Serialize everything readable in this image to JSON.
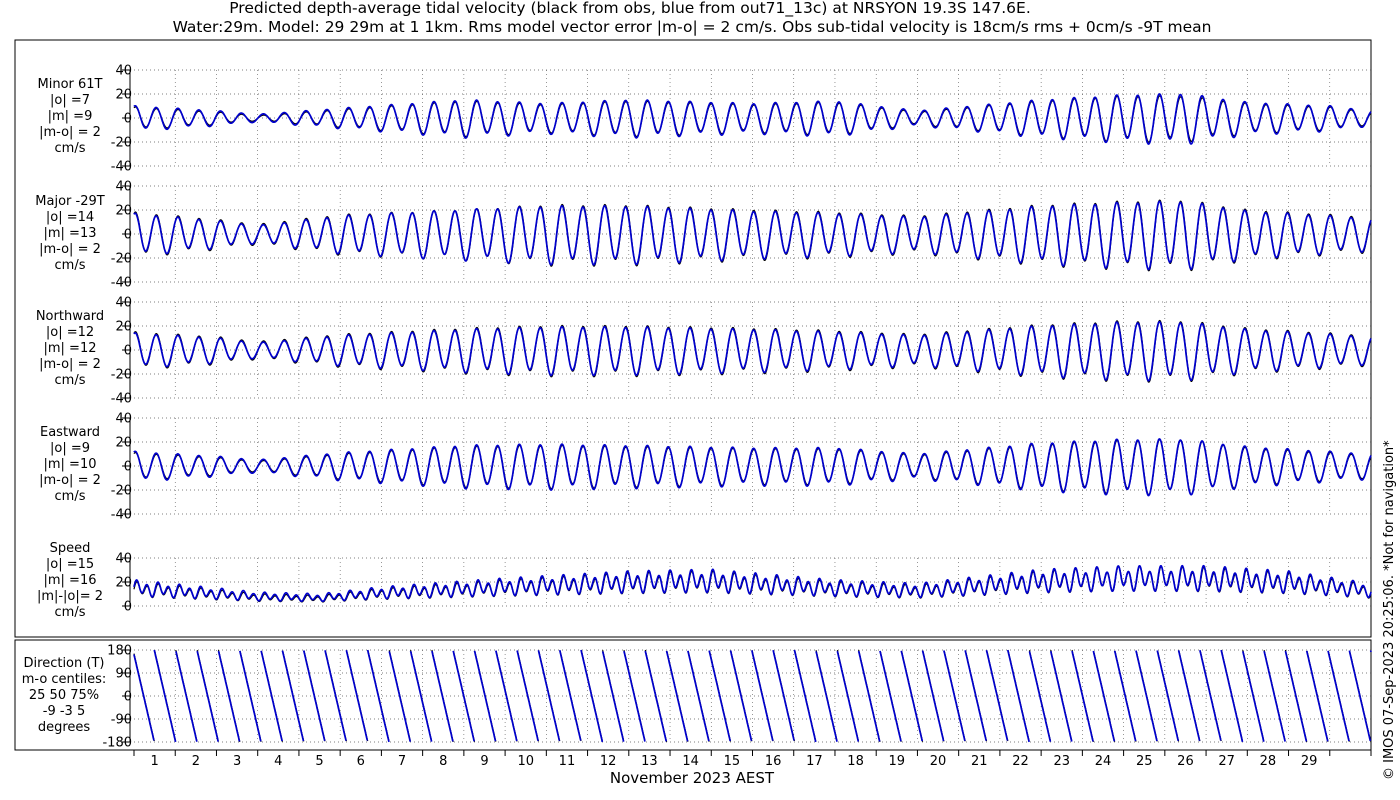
{
  "title_lines": [
    "Predicted depth-average tidal velocity (black from obs, blue from out71_13c) at NRSYON 19.3S 147.6E.",
    "Water:29m. Model: 29 29m at 1 1km. Rms model vector error |m-o| = 2 cm/s. Obs sub-tidal velocity is 18cm/s rms + 0cm/s -9T mean"
  ],
  "xlabel": "November 2023 AEST",
  "credit": "© IMOS 07-Sep-2023 20:25:06. *Not for navigation*",
  "colors": {
    "obs": "#000000",
    "model": "#0000cc",
    "grid": "#555555"
  },
  "chart_data": [
    {
      "type": "line",
      "panel": "Minor",
      "label_lines": [
        "Minor 61T",
        "|o| =7",
        "|m| =9",
        "|m-o| = 2",
        "cm/s"
      ],
      "ylim": [
        -40,
        40
      ],
      "yticks": [
        -40,
        -20,
        0,
        20,
        40
      ],
      "x_range_days": [
        0,
        30
      ],
      "series": [
        {
          "role": "obs",
          "amplitude_envelope": [
            [
              0,
              9
            ],
            [
              2,
              5
            ],
            [
              3,
              2
            ],
            [
              5,
              7
            ],
            [
              8,
              14
            ],
            [
              10,
              11
            ],
            [
              12,
              14
            ],
            [
              15,
              11
            ],
            [
              17,
              13
            ],
            [
              19,
              5
            ],
            [
              22,
              14
            ],
            [
              24,
              18
            ],
            [
              25.5,
              18
            ],
            [
              27,
              12
            ],
            [
              29,
              9
            ],
            [
              30,
              5
            ]
          ]
        },
        {
          "role": "model",
          "amplitude_envelope": [
            [
              0,
              10
            ],
            [
              2,
              6
            ],
            [
              3,
              3
            ],
            [
              5,
              8
            ],
            [
              8,
              15
            ],
            [
              10,
              12
            ],
            [
              12,
              15
            ],
            [
              15,
              12
            ],
            [
              17,
              14
            ],
            [
              19,
              6
            ],
            [
              22,
              15
            ],
            [
              24,
              19
            ],
            [
              25.5,
              20
            ],
            [
              27,
              13
            ],
            [
              29,
              10
            ],
            [
              30,
              6
            ]
          ]
        }
      ]
    },
    {
      "type": "line",
      "panel": "Major",
      "label_lines": [
        "Major -29T",
        "|o| =14",
        "|m| =13",
        "|m-o| = 2",
        "cm/s"
      ],
      "ylim": [
        -40,
        40
      ],
      "yticks": [
        -40,
        -20,
        0,
        20,
        40
      ],
      "x_range_days": [
        0,
        30
      ],
      "series": [
        {
          "role": "obs",
          "amplitude_envelope": [
            [
              0,
              18
            ],
            [
              2,
              12
            ],
            [
              3,
              8
            ],
            [
              5,
              16
            ],
            [
              8,
              20
            ],
            [
              10,
              24
            ],
            [
              12,
              24
            ],
            [
              15,
              20
            ],
            [
              17,
              18
            ],
            [
              19,
              15
            ],
            [
              22,
              24
            ],
            [
              24,
              27
            ],
            [
              25.5,
              28
            ],
            [
              27,
              20
            ],
            [
              29,
              16
            ],
            [
              30,
              14
            ]
          ]
        },
        {
          "role": "model",
          "amplitude_envelope": [
            [
              0,
              17
            ],
            [
              2,
              11
            ],
            [
              3,
              7
            ],
            [
              5,
              15
            ],
            [
              8,
              20
            ],
            [
              10,
              23
            ],
            [
              12,
              23
            ],
            [
              15,
              19
            ],
            [
              17,
              17
            ],
            [
              19,
              14
            ],
            [
              22,
              23
            ],
            [
              24,
              26
            ],
            [
              25.5,
              27
            ],
            [
              27,
              19
            ],
            [
              29,
              15
            ],
            [
              30,
              13
            ]
          ]
        }
      ]
    },
    {
      "type": "line",
      "panel": "Northward",
      "label_lines": [
        "Northward",
        "|o| =12",
        "|m| =12",
        "|m-o| = 2",
        "cm/s"
      ],
      "ylim": [
        -40,
        40
      ],
      "yticks": [
        -40,
        -20,
        0,
        20,
        40
      ],
      "x_range_days": [
        0,
        30
      ],
      "series": [
        {
          "role": "obs",
          "amplitude_envelope": [
            [
              0,
              15
            ],
            [
              2,
              11
            ],
            [
              3,
              7
            ],
            [
              5,
              13
            ],
            [
              8,
              18
            ],
            [
              10,
              20
            ],
            [
              12,
              20
            ],
            [
              15,
              18
            ],
            [
              17,
              16
            ],
            [
              19,
              13
            ],
            [
              22,
              21
            ],
            [
              24,
              24
            ],
            [
              25.5,
              24
            ],
            [
              27,
              18
            ],
            [
              29,
              14
            ],
            [
              30,
              12
            ]
          ]
        },
        {
          "role": "model",
          "amplitude_envelope": [
            [
              0,
              14
            ],
            [
              2,
              10
            ],
            [
              3,
              6
            ],
            [
              5,
              12
            ],
            [
              8,
              17
            ],
            [
              10,
              19
            ],
            [
              12,
              19
            ],
            [
              15,
              17
            ],
            [
              17,
              15
            ],
            [
              19,
              12
            ],
            [
              22,
              20
            ],
            [
              24,
              23
            ],
            [
              25.5,
              23
            ],
            [
              27,
              17
            ],
            [
              29,
              13
            ],
            [
              30,
              11
            ]
          ]
        }
      ]
    },
    {
      "type": "line",
      "panel": "Eastward",
      "label_lines": [
        "Eastward",
        "|o| =9",
        "|m| =10",
        "|m-o| = 2",
        "cm/s"
      ],
      "ylim": [
        -40,
        40
      ],
      "yticks": [
        -40,
        -20,
        0,
        20,
        40
      ],
      "x_range_days": [
        0,
        30
      ],
      "series": [
        {
          "role": "obs",
          "amplitude_envelope": [
            [
              0,
              11
            ],
            [
              2,
              7
            ],
            [
              3,
              4
            ],
            [
              5,
              10
            ],
            [
              8,
              16
            ],
            [
              10,
              17
            ],
            [
              12,
              16
            ],
            [
              15,
              14
            ],
            [
              17,
              14
            ],
            [
              19,
              9
            ],
            [
              22,
              18
            ],
            [
              24,
              21
            ],
            [
              25.5,
              22
            ],
            [
              27,
              15
            ],
            [
              29,
              11
            ],
            [
              30,
              9
            ]
          ]
        },
        {
          "role": "model",
          "amplitude_envelope": [
            [
              0,
              12
            ],
            [
              2,
              8
            ],
            [
              3,
              5
            ],
            [
              5,
              11
            ],
            [
              8,
              17
            ],
            [
              10,
              18
            ],
            [
              12,
              17
            ],
            [
              15,
              15
            ],
            [
              17,
              15
            ],
            [
              19,
              10
            ],
            [
              22,
              19
            ],
            [
              24,
              22
            ],
            [
              25.5,
              22
            ],
            [
              27,
              16
            ],
            [
              29,
              12
            ],
            [
              30,
              10
            ]
          ]
        }
      ]
    },
    {
      "type": "line",
      "panel": "Speed",
      "label_lines": [
        "Speed",
        "|o| =15",
        "|m| =16",
        "|m|-|o|= 2",
        "cm/s"
      ],
      "ylim": [
        0,
        40
      ],
      "yticks": [
        0,
        20,
        40
      ],
      "x_range_days": [
        0,
        30
      ],
      "series": [
        {
          "role": "obs",
          "mean_envelope": [
            [
              0,
              14
            ],
            [
              3,
              7
            ],
            [
              4.5,
              6
            ],
            [
              6,
              10
            ],
            [
              9,
              15
            ],
            [
              12,
              19
            ],
            [
              14,
              20
            ],
            [
              17,
              14
            ],
            [
              19,
              12
            ],
            [
              22,
              20
            ],
            [
              24,
              23
            ],
            [
              26,
              22
            ],
            [
              28,
              19
            ],
            [
              30,
              12
            ]
          ]
        },
        {
          "role": "model",
          "mean_envelope": [
            [
              0,
              15
            ],
            [
              3,
              8
            ],
            [
              4.5,
              7
            ],
            [
              6,
              11
            ],
            [
              9,
              16
            ],
            [
              12,
              20
            ],
            [
              14,
              21
            ],
            [
              17,
              15
            ],
            [
              19,
              13
            ],
            [
              22,
              21
            ],
            [
              24,
              23
            ],
            [
              26,
              23
            ],
            [
              28,
              20
            ],
            [
              30,
              13
            ]
          ]
        }
      ]
    },
    {
      "type": "line",
      "panel": "Direction",
      "label_lines": [
        "Direction (T)",
        "m-o centiles:",
        "25  50  75%",
        "-9 -3  5",
        "degrees"
      ],
      "ylim": [
        -180,
        180
      ],
      "yticks": [
        -180,
        -90,
        0,
        90,
        180
      ],
      "x_range_days": [
        0,
        30
      ],
      "series": [
        {
          "role": "obs",
          "description_values": "sawtooth wrapping between 180 and -180 twice daily"
        },
        {
          "role": "model",
          "description_values": "sawtooth wrapping between 180 and -180 twice daily"
        }
      ]
    }
  ],
  "xaxis": {
    "tick_labels": [
      "1",
      "2",
      "3",
      "4",
      "5",
      "6",
      "7",
      "8",
      "9",
      "10",
      "11",
      "12",
      "13",
      "14",
      "15",
      "16",
      "17",
      "18",
      "19",
      "20",
      "21",
      "22",
      "23",
      "24",
      "25",
      "26",
      "27",
      "28",
      "29"
    ]
  }
}
